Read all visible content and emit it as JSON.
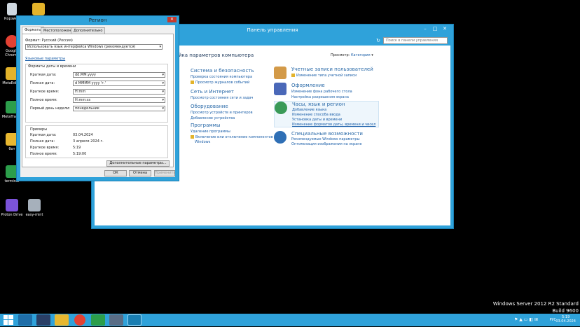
{
  "desktop": {
    "icons": [
      {
        "label": "Корзина",
        "color": "#cfd8e0"
      },
      {
        "label": "Google Chrome",
        "color": "#e34133"
      },
      {
        "label": "MetaEditor",
        "color": "#e3b32a"
      },
      {
        "label": "MetaTrader",
        "color": "#2c9e4b"
      },
      {
        "label": "бот",
        "color": "#e8b830"
      },
      {
        "label": "terminal",
        "color": "#2c9e4b"
      },
      {
        "label": "Proton Drive",
        "color": "#7b53d9"
      },
      {
        "label": "easy-mint",
        "color": "#a6b0bb"
      }
    ],
    "watermark_line1": "Windows Server 2012 R2 Standard",
    "watermark_line2": "Build 9600"
  },
  "control_panel": {
    "title": "Панель управления",
    "search_placeholder": "Поиск в панели управления",
    "heading": "йка параметров компьютера",
    "view_by_label": "Просмотр:",
    "view_by_value": "Категория",
    "categories": [
      {
        "title": "Система и безопасность",
        "links": [
          "Проверка состояния компьютера",
          "Просмотр журналов событий"
        ],
        "color": "#3a7fc6"
      },
      {
        "title": "Сеть и Интернет",
        "links": [
          "Просмотр состояния сети и задач"
        ],
        "color": "#3a7fc6"
      },
      {
        "title": "Оборудование",
        "links": [
          "Просмотр устройств и принтеров",
          "Добавление устройства"
        ],
        "color": "#6b7480"
      },
      {
        "title": "Программы",
        "links": [
          "Удаление программы",
          "Включение или отключение компонентов",
          "Windows"
        ],
        "color": "#8d6cc7"
      },
      {
        "title": "Учетные записи пользователей",
        "links": [
          "Изменение типа учетной записи"
        ],
        "color": "#d39a48"
      },
      {
        "title": "Оформление",
        "links": [
          "Изменение фона рабочего стола",
          "Настройка разрешения экрана"
        ],
        "color": "#4a68b8"
      },
      {
        "title": "Часы, язык и регион",
        "links": [
          "Добавление языка",
          "Изменение способа ввода",
          "Установка даты и времени",
          "Изменение форматов даты, времени и чисел"
        ],
        "color": "#3a9a58"
      },
      {
        "title": "Специальные возможности",
        "links": [
          "Рекомендуемые Windows параметры",
          "Оптимизация изображения на экране"
        ],
        "color": "#2f6fb5"
      }
    ]
  },
  "region": {
    "title": "Регион",
    "tabs": [
      "Форматы",
      "Местоположение",
      "Дополнительно"
    ],
    "format_label": "Формат: Русский (Россия)",
    "format_value": "Использовать язык интерфейса Windows (рекомендуется)",
    "language_link": "Языковые параметры",
    "group_title": "Форматы даты и времени",
    "fields": [
      {
        "label": "Краткая дата:",
        "value": "dd.MM.yyyy"
      },
      {
        "label": "Полная дата:",
        "value": "d MMMM yyyy 'г.'"
      },
      {
        "label": "Краткое время:",
        "value": "H:mm"
      },
      {
        "label": "Полное время:",
        "value": "H:mm:ss"
      },
      {
        "label": "Первый день недели:",
        "value": "понедельник"
      }
    ],
    "examples_title": "Примеры",
    "examples": [
      {
        "label": "Краткая дата:",
        "value": "03.04.2024"
      },
      {
        "label": "Полная дата:",
        "value": "3 апреля 2024 г."
      },
      {
        "label": "Краткое время:",
        "value": "5:19"
      },
      {
        "label": "Полное время:",
        "value": "5:19:00"
      }
    ],
    "more_button": "Дополнительные параметры...",
    "ok": "ОК",
    "cancel": "Отмена",
    "apply": "Применить"
  },
  "taskbar": {
    "language": "РУС",
    "time": "5:19",
    "date": "03.04.2024"
  },
  "colors": {
    "accent": "#2fa2da",
    "link": "#1a5ea8"
  }
}
